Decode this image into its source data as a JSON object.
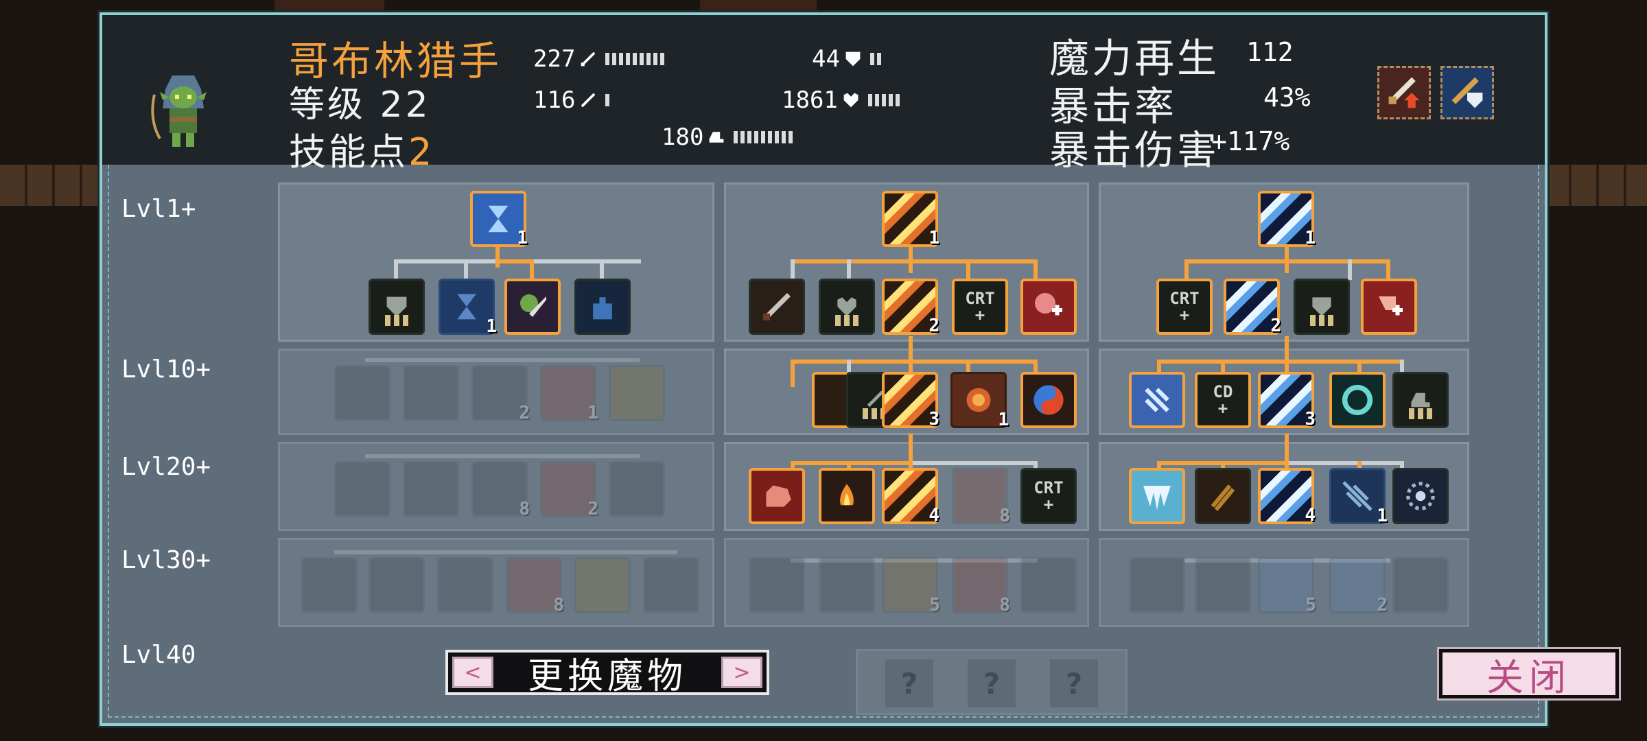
{
  "character": {
    "name": "哥布林猎手",
    "level_text": "等级 22",
    "skill_points_label": "技能点",
    "skill_points_value": "2"
  },
  "stats": {
    "attack": "227",
    "magic_attack": "116",
    "defense": "44",
    "hp": "1861",
    "speed": "180"
  },
  "right_stats": {
    "mana_regen_label": "魔力再生",
    "mana_regen_value": "112",
    "crit_rate_label": "暴击率",
    "crit_rate_value": "43%",
    "crit_damage_label": "暴击伤害",
    "crit_damage_value": "+117%"
  },
  "level_tiers": [
    "Lvl1+",
    "Lvl10+",
    "Lvl20+",
    "Lvl30+",
    "Lvl40"
  ],
  "skills": {
    "left_root": "1",
    "left_r1_slot2": "1",
    "mid_root": "1",
    "mid_r1_center": "2",
    "mid_r2_center": "3",
    "mid_r2_slot4": "1",
    "mid_r3_center": "4",
    "right_root": "1",
    "right_r1_center": "2",
    "right_r2_center": "3",
    "right_r3_center": "4",
    "right_r3_slot4": "1",
    "faded_left_r2_3": "2",
    "faded_left_r2_4": "1",
    "faded_left_r3_3": "8",
    "faded_left_r3_4": "2",
    "faded_left_r4_4": "8",
    "faded_mid_r3_4": "8",
    "faded_mid_r4_3": "5",
    "faded_mid_r4_4": "8",
    "faded_right_r4_3": "5",
    "faded_right_r4_4": "2",
    "crt_text": "CRT",
    "cd_text": "CD"
  },
  "buttons": {
    "switch_monster": "更换魔物",
    "prev": "<",
    "next": ">",
    "close": "关闭",
    "locked": "?"
  },
  "colors": {
    "accent_orange": "#f5a23c",
    "panel_border": "#8fd0d0",
    "close_text": "#b84a86"
  }
}
